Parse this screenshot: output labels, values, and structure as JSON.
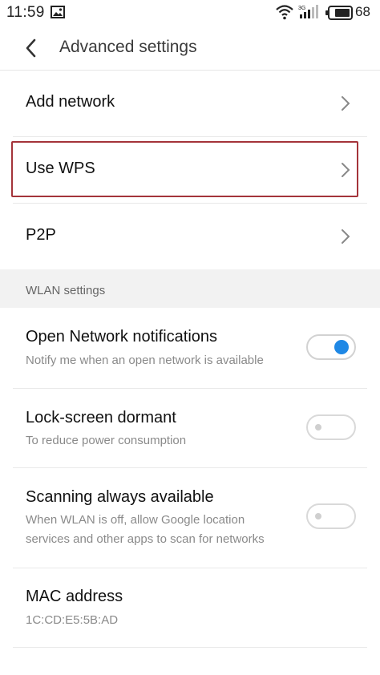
{
  "status_bar": {
    "time": "11:59",
    "battery": "68",
    "icons": [
      "image-icon",
      "wifi-icon",
      "signal-icon",
      "battery-icon"
    ]
  },
  "header": {
    "title": "Advanced settings",
    "back_icon": "back-arrow-icon"
  },
  "nav_items": [
    {
      "label": "Add network"
    },
    {
      "label": "Use WPS",
      "highlighted": true
    },
    {
      "label": "P2P"
    }
  ],
  "section": {
    "label": "WLAN settings"
  },
  "settings": [
    {
      "title": "Open Network notifications",
      "subtitle": "Notify me when an open network is available",
      "enabled": true
    },
    {
      "title": "Lock-screen dormant",
      "subtitle": "To reduce power consumption",
      "enabled": false
    },
    {
      "title": "Scanning always available",
      "subtitle": "When WLAN is off, allow Google location services and other apps to scan for networks",
      "enabled": false
    }
  ],
  "mac": {
    "title": "MAC address",
    "value": "1C:CD:E5:5B:AD"
  },
  "colors": {
    "accent": "#1f88e5",
    "highlight_border": "#a4343a",
    "section_bg": "#f2f2f2"
  }
}
